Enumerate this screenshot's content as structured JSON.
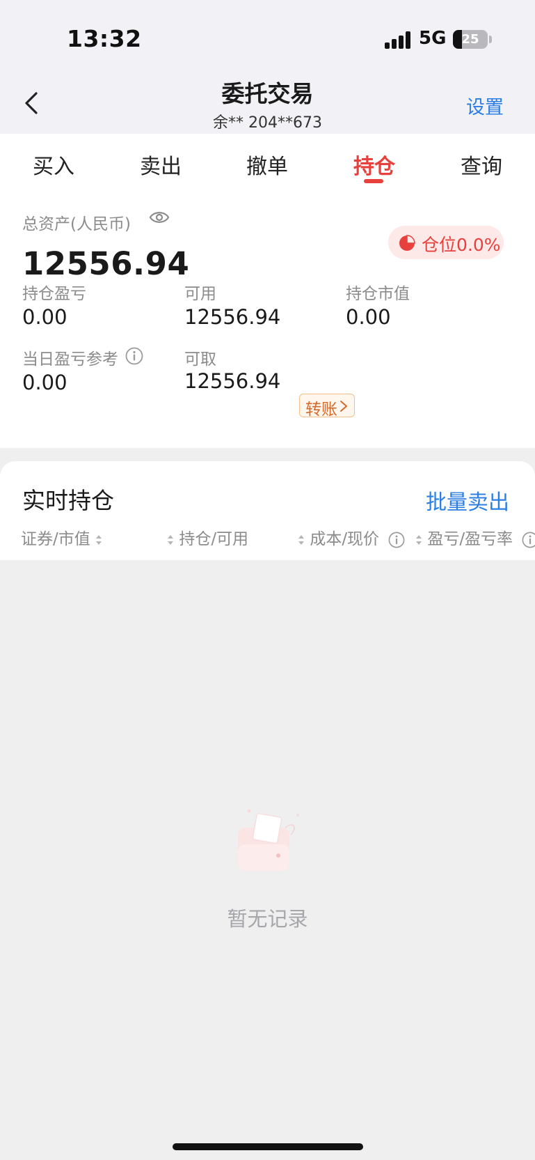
{
  "status_bar": {
    "time": "13:32",
    "network": "5G",
    "battery": "25",
    "battery_level": 0.25
  },
  "header": {
    "title": "委托交易",
    "account": "余**  204**673",
    "settings_label": "设置"
  },
  "tabs": [
    {
      "label": "买入",
      "active": false
    },
    {
      "label": "卖出",
      "active": false
    },
    {
      "label": "撤单",
      "active": false
    },
    {
      "label": "持仓",
      "active": true
    },
    {
      "label": "查询",
      "active": false
    }
  ],
  "assets": {
    "total_label": "总资产(人民币)",
    "total_value": "12556.94",
    "position_ratio_label": "仓位0.0%",
    "stats": {
      "holding_pnl_label": "持仓盈亏",
      "holding_pnl_value": "0.00",
      "available_label": "可用",
      "available_value": "12556.94",
      "market_value_label": "持仓市值",
      "market_value_value": "0.00",
      "today_pnl_label": "当日盈亏参考",
      "today_pnl_value": "0.00",
      "withdrawable_label": "可取",
      "withdrawable_value": "12556.94"
    },
    "transfer_label": "转账"
  },
  "holdings": {
    "title": "实时持仓",
    "batch_sell_label": "批量卖出",
    "columns": [
      "证券/市值",
      "持仓/可用",
      "成本/现价",
      "盈亏/盈亏率"
    ],
    "empty_text": "暂无记录"
  },
  "colors": {
    "accent_red": "#e8403c",
    "link_blue": "#2b7ee3",
    "transfer_orange": "#d5692a"
  },
  "icons": [
    "back-arrow-icon",
    "eye-icon",
    "pie-chart-icon",
    "info-icon",
    "chevron-right-icon",
    "sort-icon",
    "empty-box-icon"
  ]
}
